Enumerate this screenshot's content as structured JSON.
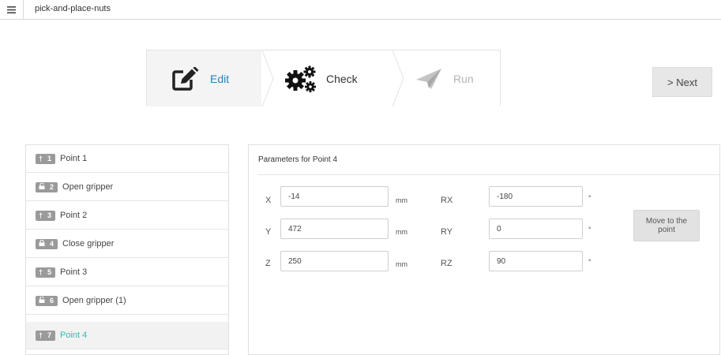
{
  "header": {
    "menu_icon": "hamburger-icon",
    "title": "pick-and-place-nuts"
  },
  "stepper": {
    "steps": [
      {
        "label": "Edit",
        "icon": "edit-icon",
        "state": "active"
      },
      {
        "label": "Check",
        "icon": "gears-icon",
        "state": "enabled"
      },
      {
        "label": "Run",
        "icon": "paper-plane-icon",
        "state": "disabled"
      }
    ],
    "next_label": "> Next"
  },
  "program": {
    "items": [
      {
        "num": "1",
        "icon": "pin-icon",
        "label": "Point 1"
      },
      {
        "num": "2",
        "icon": "unlock-icon",
        "label": "Open gripper"
      },
      {
        "num": "3",
        "icon": "pin-icon",
        "label": "Point 2"
      },
      {
        "num": "4",
        "icon": "lock-icon",
        "label": "Close gripper"
      },
      {
        "num": "5",
        "icon": "pin-icon",
        "label": "Point 3"
      },
      {
        "num": "6",
        "icon": "unlock-icon",
        "label": "Open gripper (1)"
      },
      {
        "num": "7",
        "icon": "pin-icon",
        "label": "Point 4",
        "selected": true
      }
    ]
  },
  "params": {
    "title": "Parameters for  Point 4",
    "fields": [
      {
        "label": "X",
        "value": "-14",
        "unit": "mm"
      },
      {
        "label": "Y",
        "value": "472",
        "unit": "mm"
      },
      {
        "label": "Z",
        "value": "250",
        "unit": "mm"
      },
      {
        "label": "RX",
        "value": "-180",
        "unit": "°"
      },
      {
        "label": "RY",
        "value": "0",
        "unit": "°"
      },
      {
        "label": "RZ",
        "value": "90",
        "unit": "°"
      }
    ],
    "move_label": "Move to the point"
  },
  "colors": {
    "accent_blue": "#2c7fb8",
    "selected_teal": "#3cb4b4",
    "badge_gray": "#9a9a9a"
  }
}
